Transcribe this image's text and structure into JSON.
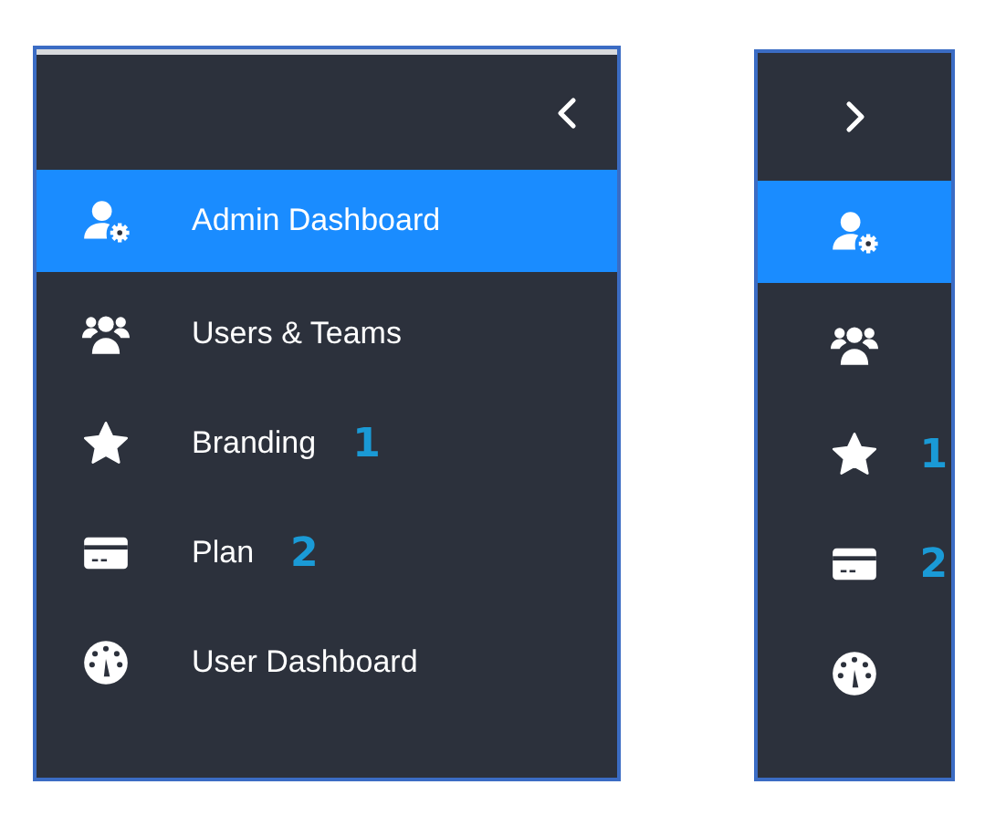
{
  "panels": [
    {
      "kind": "expanded",
      "items": [
        {
          "kind": "admin",
          "label": "Admin Dashboard",
          "selected": true
        },
        {
          "kind": "users",
          "label": "Users & Teams",
          "selected": false
        },
        {
          "kind": "star",
          "label": "Branding",
          "selected": false,
          "annotation": "1"
        },
        {
          "kind": "card",
          "label": "Plan",
          "selected": false,
          "annotation": "2"
        },
        {
          "kind": "gauge",
          "label": "User Dashboard",
          "selected": false
        }
      ]
    },
    {
      "kind": "collapsed",
      "items": [
        {
          "kind": "admin",
          "selected": true
        },
        {
          "kind": "users",
          "selected": false
        },
        {
          "kind": "star",
          "selected": false,
          "annotation": "1"
        },
        {
          "kind": "card",
          "selected": false,
          "annotation": "2"
        },
        {
          "kind": "gauge",
          "selected": false
        }
      ]
    }
  ]
}
